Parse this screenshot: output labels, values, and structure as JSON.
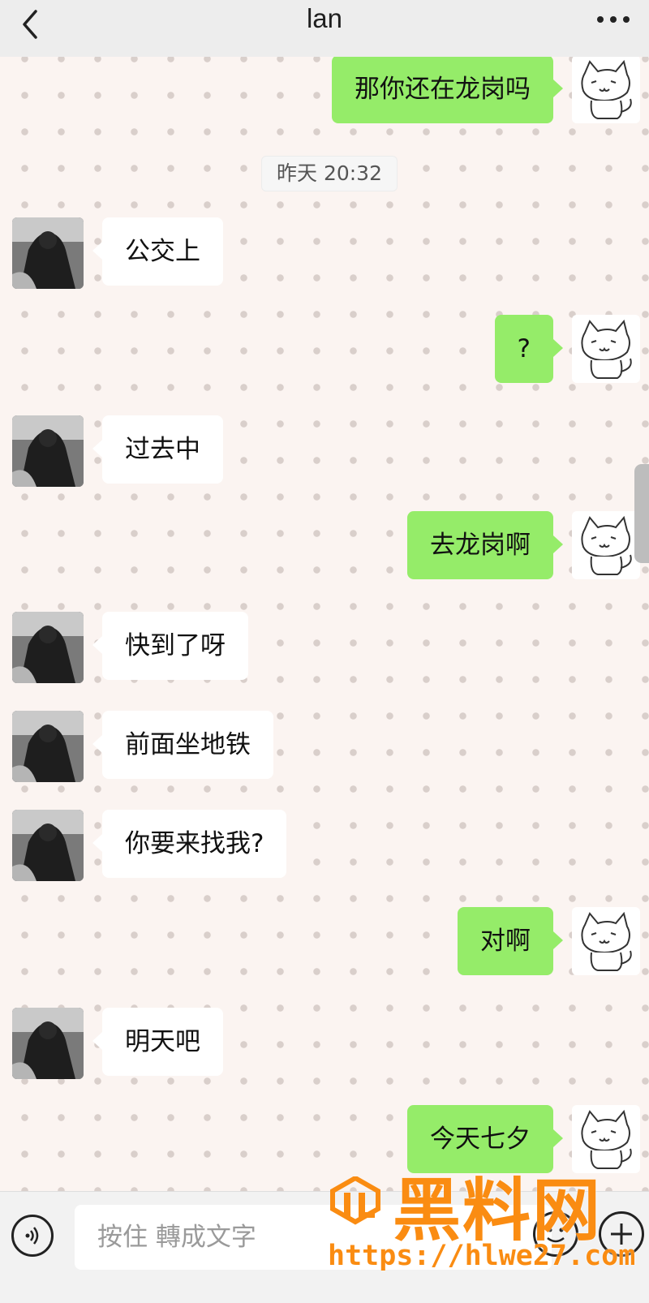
{
  "header": {
    "title": "lan"
  },
  "messages": [
    {
      "side": "right",
      "text": "那你还在龙岗吗"
    },
    {
      "type": "timestamp",
      "text": "昨天 20:32"
    },
    {
      "side": "left",
      "text": "公交上"
    },
    {
      "side": "right",
      "text": "?"
    },
    {
      "side": "left",
      "text": "过去中"
    },
    {
      "side": "right",
      "text": "去龙岗啊"
    },
    {
      "side": "left",
      "text": "快到了呀"
    },
    {
      "side": "left",
      "text": "前面坐地铁"
    },
    {
      "side": "left",
      "text": "你要来找我?"
    },
    {
      "side": "right",
      "text": "对啊"
    },
    {
      "side": "left",
      "text": "明天吧"
    },
    {
      "side": "right",
      "text": "今天七夕"
    }
  ],
  "input": {
    "hold_to_talk": "按住 轉成文字"
  },
  "watermark": {
    "name": "黑料网",
    "url": "https://hlwe27.com"
  },
  "colors": {
    "self_bubble": "#95ec69",
    "other_bubble": "#ffffff",
    "watermark": "#fa8c12"
  },
  "icons": [
    "back-icon",
    "more-icon",
    "voice-icon",
    "emoji-icon",
    "plus-icon",
    "cat-avatar",
    "person-avatar"
  ]
}
